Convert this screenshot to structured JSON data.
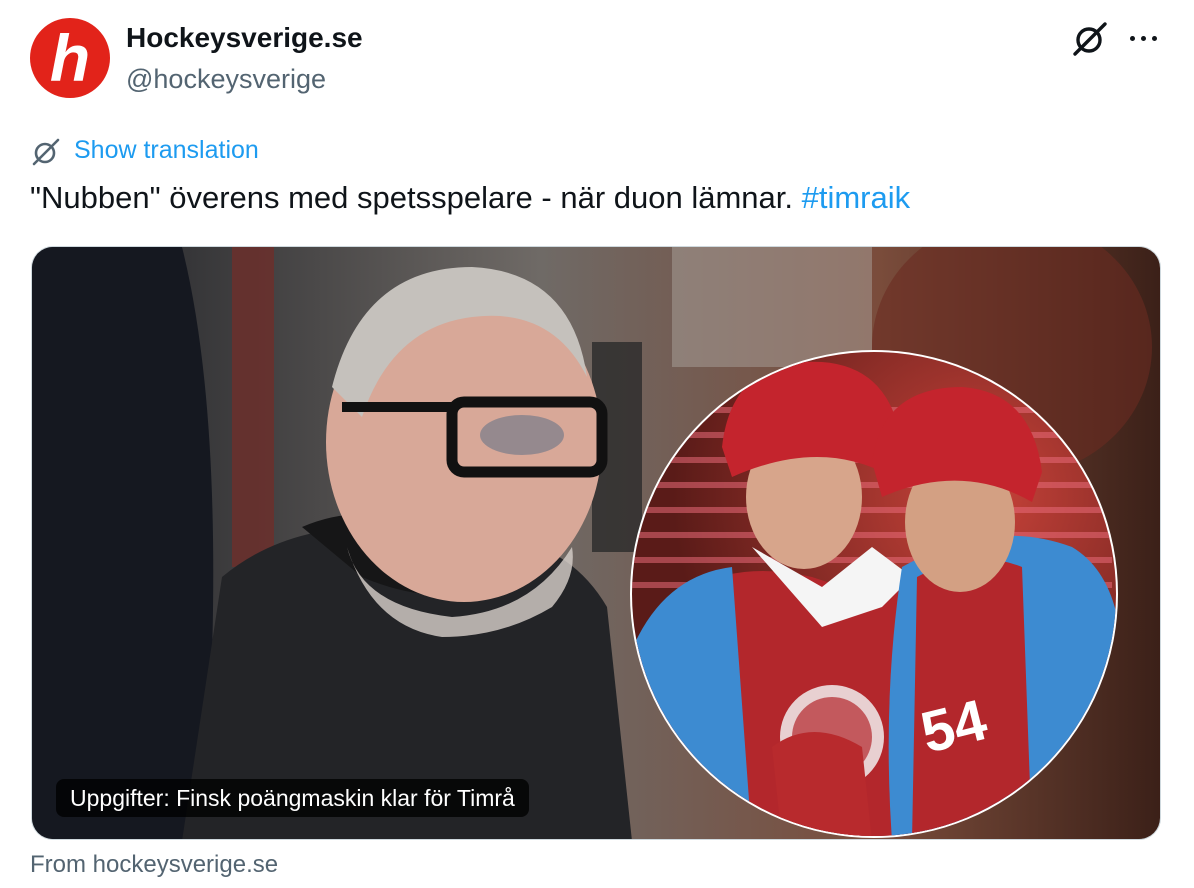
{
  "account": {
    "display_name": "Hockeysverige.se",
    "handle": "@hockeysverige",
    "avatar_letter": "h",
    "avatar_color": "#e2231a"
  },
  "icons": {
    "grok": "grok-icon",
    "more": "more-options-icon",
    "translate": "translate-icon"
  },
  "tweet": {
    "show_translation": "Show translation",
    "text": "\"Nubben\" överens med spetsspelare - när duon lämnar. ",
    "hashtag": "#timraik"
  },
  "card": {
    "caption": "Uppgifter: Finsk poängmaskin klar för Timrå",
    "source": "From hockeysverige.se",
    "jersey_number": "54"
  },
  "colors": {
    "link": "#1d9bf0",
    "text": "#0f1419",
    "muted": "#536471",
    "border": "#cfd9de"
  }
}
